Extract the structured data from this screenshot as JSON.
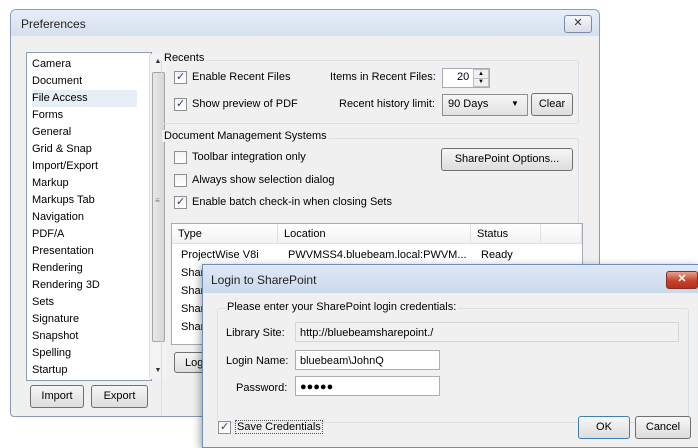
{
  "preferences": {
    "title": "Preferences",
    "close_glyph": "✕",
    "categories": [
      "Camera",
      "Document",
      "File Access",
      "Forms",
      "General",
      "Grid & Snap",
      "Import/Export",
      "Markup",
      "Markups Tab",
      "Navigation",
      "PDF/A",
      "Presentation",
      "Rendering",
      "Rendering 3D",
      "Sets",
      "Signature",
      "Snapshot",
      "Spelling",
      "Startup"
    ],
    "selected_category": "File Access",
    "import_label": "Import",
    "export_label": "Export",
    "recents": {
      "group_label": "Recents",
      "enable_recent_files": {
        "label": "Enable Recent Files",
        "checked": true
      },
      "show_preview": {
        "label": "Show preview of PDF",
        "checked": true
      },
      "items_label": "Items in Recent Files:",
      "items_value": "20",
      "history_label": "Recent history limit:",
      "history_value": "90 Days",
      "clear_label": "Clear"
    },
    "dms": {
      "group_label": "Document Management Systems",
      "toolbar_integration": {
        "label": "Toolbar integration only",
        "checked": false
      },
      "always_show_selection": {
        "label": "Always show selection dialog",
        "checked": false
      },
      "batch_checkin": {
        "label": "Enable batch check-in when closing Sets",
        "checked": true
      },
      "sharepoint_options_label": "SharePoint Options...",
      "table": {
        "headers": [
          "Type",
          "Location",
          "Status"
        ],
        "rows": [
          {
            "type": "ProjectWise V8i",
            "location": "PWVMSS4.bluebeam.local:PWVM...",
            "status": "Ready"
          },
          {
            "type": "Shar",
            "location": "",
            "status": ""
          },
          {
            "type": "Shar",
            "location": "",
            "status": ""
          },
          {
            "type": "Shar",
            "location": "",
            "status": ""
          },
          {
            "type": "Shar",
            "location": "",
            "status": ""
          }
        ]
      },
      "login_button_partial": "Log"
    }
  },
  "login_dialog": {
    "title": "Login to SharePoint",
    "close_glyph": "✕",
    "instructions": "Please enter your SharePoint login credentials:",
    "library_site_label": "Library Site:",
    "library_site_value": "http://bluebeamsharepoint./",
    "login_name_label": "Login Name:",
    "login_name_value": "bluebeam\\JohnQ",
    "password_label": "Password:",
    "password_value": "●●●●●",
    "save_credentials": {
      "label": "Save Credentials",
      "checked": true
    },
    "ok_label": "OK",
    "cancel_label": "Cancel"
  },
  "icons": {
    "spin_up": "▲",
    "spin_down": "▼",
    "combo_arrow": "▼",
    "scroll_up": "▲",
    "scroll_down": "▼",
    "grip": "≡"
  }
}
